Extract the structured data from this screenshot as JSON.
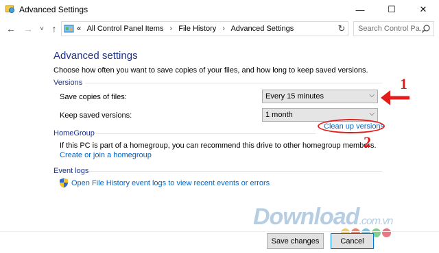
{
  "window": {
    "title": "Advanced Settings",
    "minimize": "—",
    "maximize": "☐",
    "close": "✕"
  },
  "navigation": {
    "back": "←",
    "forward": "→",
    "recent": "˅",
    "up": "↑",
    "overflow": "«",
    "breadcrumbs": [
      "All Control Panel Items",
      "File History",
      "Advanced Settings"
    ],
    "separator": "›",
    "dropdown": "˅",
    "refresh": "↻"
  },
  "search": {
    "placeholder": "Search Control Pa..."
  },
  "main": {
    "heading": "Advanced settings",
    "description": "Choose how often you want to save copies of your files, and how long to keep saved versions.",
    "versions": {
      "title": "Versions",
      "save_copies_label": "Save copies of files:",
      "save_copies_value": "Every 15 minutes",
      "keep_versions_label": "Keep saved versions:",
      "keep_versions_value": "1 month",
      "clean_up_link": "Clean up versions"
    },
    "homegroup": {
      "title": "HomeGroup",
      "text": "If this PC is part of a homegroup, you can recommend this drive to other homegroup members.",
      "link": "Create or join a homegroup"
    },
    "event_logs": {
      "title": "Event logs",
      "link": "Open File History event logs to view recent events or errors"
    }
  },
  "annotations": {
    "num1": "1",
    "num2": "2",
    "color": "#e41b1b"
  },
  "watermark": {
    "brand": "Download",
    "domain": ".com.vn",
    "dot_colors": [
      "#e8bd3b",
      "#e55b3b",
      "#4fb4d8",
      "#5bbf6a",
      "#e04a5a"
    ]
  },
  "footer": {
    "save_label": "Save changes",
    "cancel_label": "Cancel"
  },
  "colors": {
    "heading": "#1e3287",
    "link": "#0066cc",
    "accent": "#0078d7"
  }
}
